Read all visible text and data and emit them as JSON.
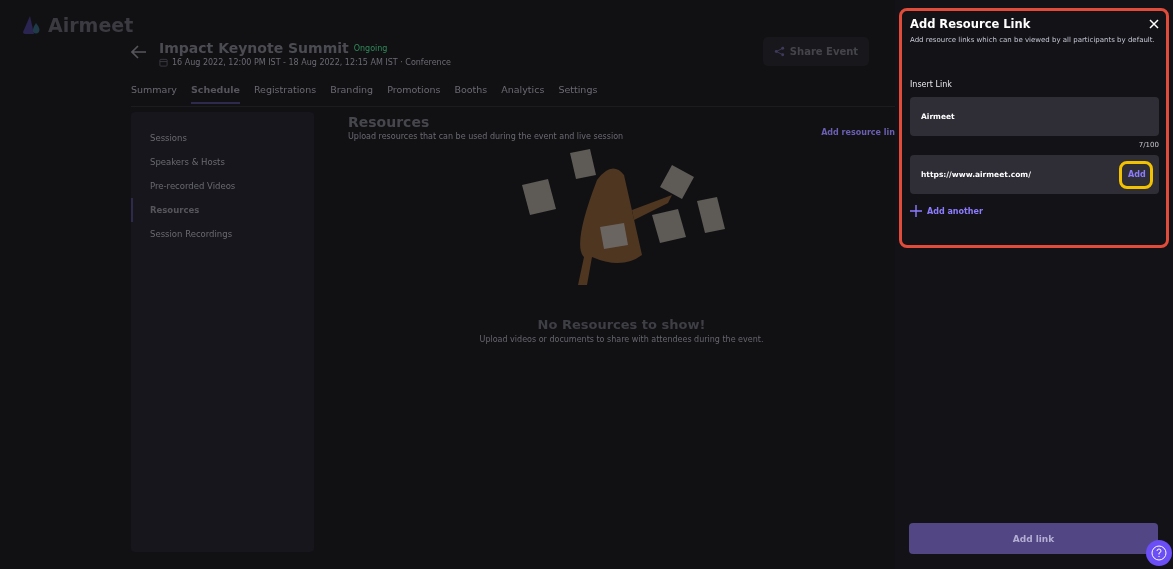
{
  "brand": {
    "name": "Airmeet"
  },
  "event": {
    "title": "Impact Keynote Summit",
    "status": "Ongoing",
    "schedule": "16 Aug 2022, 12:00 PM IST - 18 Aug 2022, 12:15 AM IST · Conference",
    "share_button": "Share Event"
  },
  "tabs": [
    {
      "label": "Summary",
      "selected": false
    },
    {
      "label": "Schedule",
      "selected": true
    },
    {
      "label": "Registrations",
      "selected": false
    },
    {
      "label": "Branding",
      "selected": false
    },
    {
      "label": "Promotions",
      "selected": false
    },
    {
      "label": "Booths",
      "selected": false
    },
    {
      "label": "Analytics",
      "selected": false
    },
    {
      "label": "Settings",
      "selected": false
    }
  ],
  "sidebar": {
    "items": [
      {
        "label": "Sessions",
        "selected": false
      },
      {
        "label": "Speakers & Hosts",
        "selected": false
      },
      {
        "label": "Pre-recorded Videos",
        "selected": false
      },
      {
        "label": "Resources",
        "selected": true
      },
      {
        "label": "Session Recordings",
        "selected": false
      }
    ]
  },
  "resources": {
    "title": "Resources",
    "subtitle": "Upload resources that can be used during the event and live session",
    "add_link": "Add resource lin",
    "empty_title": "No Resources to show!",
    "empty_text": "Upload videos or documents to share with attendees during the event."
  },
  "panel": {
    "title": "Add Resource Link",
    "description": "Add resource links which can be viewed by all participants by default.",
    "insert_label": "Insert Link",
    "name_value": "Airmeet",
    "counter": "7/100",
    "url_value": "https://www.airmeet.com/",
    "add_button": "Add",
    "add_another": "Add another",
    "submit_button": "Add link"
  }
}
